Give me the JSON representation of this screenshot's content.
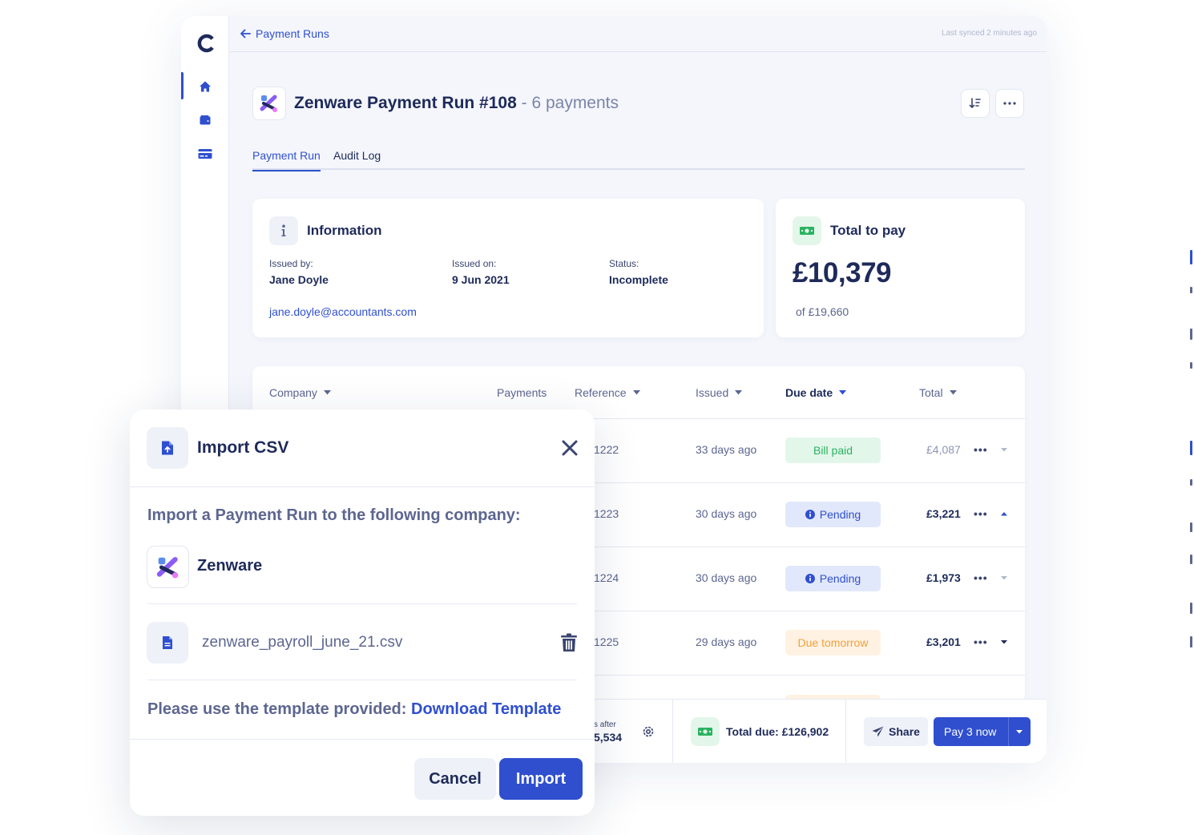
{
  "topbar": {
    "back_label": "Payment Runs",
    "sync_text": "Last synced 2 minutes ago"
  },
  "header": {
    "title": "Zenware Payment Run #108",
    "subtitle": " - 6 payments"
  },
  "tabs": [
    {
      "label": "Payment Run",
      "active": true
    },
    {
      "label": "Audit Log",
      "active": false
    }
  ],
  "info": {
    "title": "Information",
    "issued_by_label": "Issued by:",
    "issued_by": "Jane Doyle",
    "issued_on_label": "Issued on:",
    "issued_on": "9 Jun 2021",
    "status_label": "Status:",
    "status": "Incomplete",
    "email": "jane.doyle@accountants.com"
  },
  "total_card": {
    "title": "Total to pay",
    "amount": "£10,379",
    "of": "of £19,660"
  },
  "table": {
    "headers": {
      "company": "Company",
      "payments": "Payments",
      "reference": "Reference",
      "issued": "Issued",
      "due_date": "Due date",
      "total": "Total"
    },
    "rows": [
      {
        "reference": "1222",
        "issued": "33 days ago",
        "status": "Bill paid",
        "total": "£4,087"
      },
      {
        "reference": "1223",
        "issued": "30 days ago",
        "status": "Pending",
        "total": "£3,221"
      },
      {
        "reference": "1224",
        "issued": "30 days ago",
        "status": "Pending",
        "total": "£1,973"
      },
      {
        "reference": "1225",
        "issued": "29 days ago",
        "status": "Due tomorrow",
        "total": "£3,201"
      }
    ],
    "row_menu": "•••"
  },
  "footer": {
    "after_label": "s after",
    "after_value": "5,534",
    "total_due": "Total due: £126,902",
    "share_label": "Share",
    "pay_label": "Pay 3 now"
  },
  "modal": {
    "title": "Import CSV",
    "prompt": "Import a Payment Run to the following company:",
    "company": "Zenware",
    "file_name": "zenware_payroll_june_21.csv",
    "template_text": "Please use the template provided: ",
    "template_link": "Download Template",
    "cancel_label": "Cancel",
    "import_label": "Import"
  },
  "colors": {
    "accent": "#2f4fcf",
    "paid": "#2bb361",
    "pending": "#2f4fcf",
    "due": "#f2a13b",
    "text_dark": "#1e2a5a"
  }
}
